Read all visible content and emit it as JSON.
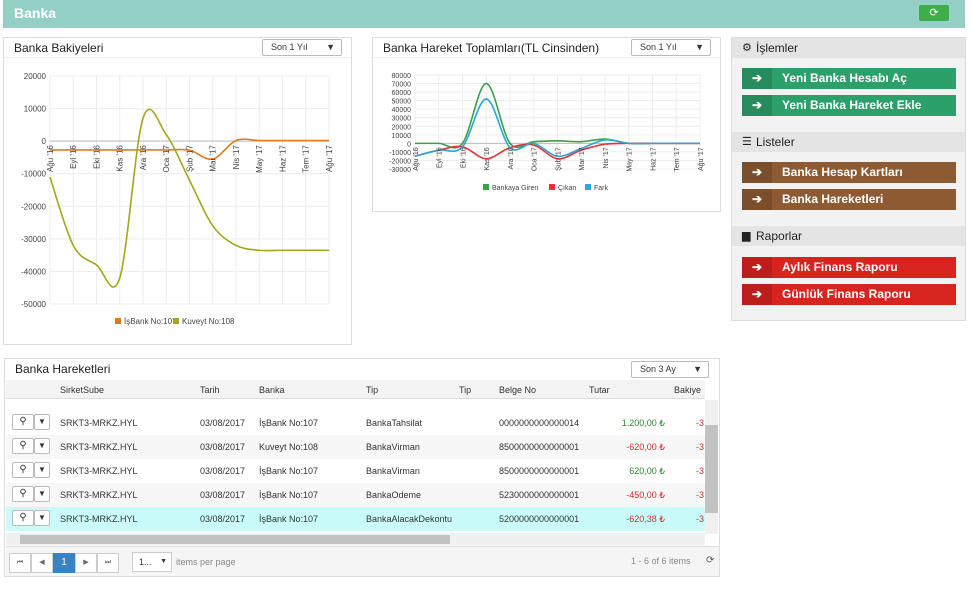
{
  "app": {
    "title": "Banka"
  },
  "balances": {
    "title": "Banka Bakiyeleri",
    "period": "Son 1 Yıl",
    "chart_data": {
      "type": "line",
      "categories": [
        "Ağu '16",
        "Eyl '16",
        "Eki '16",
        "Kas '16",
        "Ara '16",
        "Oca '17",
        "Şub '17",
        "Mar '17",
        "Nis '17",
        "May '17",
        "Haz '17",
        "Tem '17",
        "Ağu '17"
      ],
      "yticks": [
        "20000",
        "10000",
        "0",
        "-10000",
        "-20000",
        "-30000",
        "-40000",
        "-50000"
      ],
      "ylim": [
        -50000,
        20000
      ],
      "series": [
        {
          "name": "İşBank No:107",
          "color": "#e07b1c",
          "values": [
            -2700,
            -2700,
            -2700,
            -2700,
            -2700,
            -2700,
            -2800,
            -5500,
            200,
            200,
            200,
            200,
            200
          ]
        },
        {
          "name": "Kuveyt No:108",
          "color": "#a8a51a",
          "values": [
            -11000,
            -32000,
            -38000,
            -42000,
            7000,
            2000,
            -12000,
            -26000,
            -32000,
            -33500,
            -33500,
            -33500,
            -33500
          ]
        }
      ]
    }
  },
  "movements": {
    "title": "Banka Hareket Toplamları(TL Cinsinden)",
    "period": "Son 1 Yıl",
    "chart_data": {
      "type": "area",
      "categories": [
        "Ağu '16",
        "Eyl '16",
        "Eki '16",
        "Kas '16",
        "Ara '16",
        "Oca '17",
        "Şub '17",
        "Mar '17",
        "Nis '17",
        "May '17",
        "Haz '17",
        "Tem '17",
        "Ağu '17"
      ],
      "yticks": [
        "80000",
        "70000",
        "60000",
        "50000",
        "40000",
        "30000",
        "20000",
        "10000",
        "0",
        "-10000",
        "-20000",
        "-30000"
      ],
      "ylim": [
        -30000,
        80000
      ],
      "series": [
        {
          "name": "Bankaya Giren",
          "color": "#3aa046",
          "values": [
            0,
            0,
            0,
            70000,
            0,
            2000,
            3000,
            2000,
            5000,
            0,
            0,
            0,
            0
          ]
        },
        {
          "name": "Çıkan",
          "color": "#e8333b",
          "values": [
            -15000,
            -8000,
            -4000,
            -18000,
            -5000,
            -2000,
            -18000,
            -8000,
            -1000,
            0,
            0,
            0,
            0
          ]
        },
        {
          "name": "Fark",
          "color": "#29a7d8",
          "values": [
            -15000,
            -8000,
            -4000,
            52000,
            -5000,
            0,
            -15000,
            -6000,
            4000,
            0,
            0,
            0,
            0
          ]
        }
      ]
    }
  },
  "actions": {
    "header": "İşlemler",
    "buttons": [
      "Yeni Banka Hesabı Aç",
      "Yeni Banka Hareket Ekle"
    ]
  },
  "lists": {
    "header": "Listeler",
    "buttons": [
      "Banka Hesap Kartları",
      "Banka Hareketleri"
    ]
  },
  "reports": {
    "header": "Raporlar",
    "buttons": [
      "Aylık Finans Raporu",
      "Günlük Finans Raporu"
    ]
  },
  "grid": {
    "title": "Banka Hareketleri",
    "period": "Son 3 Ay",
    "columns": [
      "SirketSube",
      "Tarih",
      "Banka",
      "Tip",
      "Tip",
      "Belge No",
      "Tutar",
      "Bakiye"
    ],
    "rows": [
      {
        "sube": "SRKT3-MRKZ.HYL",
        "tarih": "03/08/2017",
        "banka": "İşBank No:107",
        "tip": "BankaTahsilat",
        "belge": "0000000000000014",
        "tutar": "1.200,00 ₺",
        "bakiye": "-3"
      },
      {
        "sube": "SRKT3-MRKZ.HYL",
        "tarih": "03/08/2017",
        "banka": "Kuveyt No:108",
        "tip": "BankaVirman",
        "belge": "8500000000000001",
        "tutar": "-620,00 ₺",
        "bakiye": "-3"
      },
      {
        "sube": "SRKT3-MRKZ.HYL",
        "tarih": "03/08/2017",
        "banka": "İşBank No:107",
        "tip": "BankaVirman",
        "belge": "8500000000000001",
        "tutar": "620,00 ₺",
        "bakiye": "-3"
      },
      {
        "sube": "SRKT3-MRKZ.HYL",
        "tarih": "03/08/2017",
        "banka": "İşBank No:107",
        "tip": "BankaOdeme",
        "belge": "5230000000000001",
        "tutar": "-450,00 ₺",
        "bakiye": "-3"
      },
      {
        "sube": "SRKT3-MRKZ.HYL",
        "tarih": "03/08/2017",
        "banka": "İşBank No:107",
        "tip": "BankaAlacakDekontu",
        "belge": "5200000000000001",
        "tutar": "-620,38 ₺",
        "bakiye": "-3"
      }
    ],
    "pager": {
      "page": "1",
      "page_size": "1...",
      "per_page_label": "items per page",
      "summary": "1 - 6 of 6 items"
    }
  }
}
